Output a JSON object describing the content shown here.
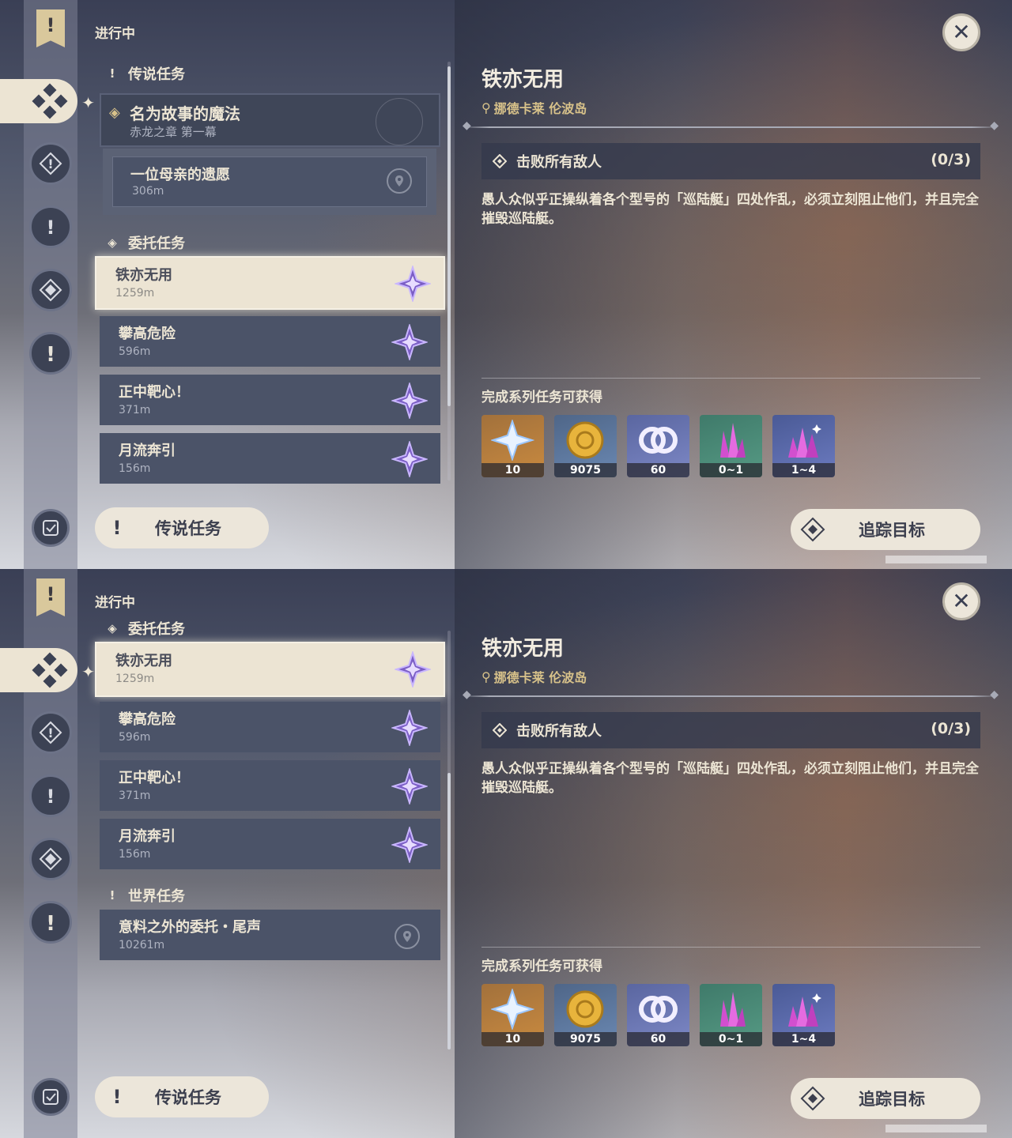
{
  "screens": [
    {
      "status": "进行中",
      "sections": [
        {
          "header": "传说任务"
        },
        {
          "header": "委托任务"
        }
      ],
      "legend_quest": {
        "title": "名为故事的魔法",
        "chapter": "赤龙之章 第一幕"
      },
      "legend_sub": {
        "title": "一位母亲的遗愿",
        "distance": "306m"
      },
      "commissions": [
        {
          "title": "铁亦无用",
          "distance": "1259m"
        },
        {
          "title": "攀高危险",
          "distance": "596m"
        },
        {
          "title": "正中靶心！",
          "distance": "371m"
        },
        {
          "title": "月流奔引",
          "distance": "156m"
        }
      ],
      "legend_button": "传说任务",
      "track_button": "追踪目标"
    },
    {
      "status": "进行中",
      "sections": [
        {
          "header": "委托任务"
        },
        {
          "header": "世界任务"
        }
      ],
      "commissions": [
        {
          "title": "铁亦无用",
          "distance": "1259m"
        },
        {
          "title": "攀高危险",
          "distance": "596m"
        },
        {
          "title": "正中靶心！",
          "distance": "371m"
        },
        {
          "title": "月流奔引",
          "distance": "156m"
        }
      ],
      "world_quest": {
        "title": "意料之外的委托・尾声",
        "distance": "10261m"
      },
      "legend_button": "传说任务",
      "track_button": "追踪目标"
    }
  ],
  "detail": {
    "title": "铁亦无用",
    "location": "挪德卡莱 伦波岛",
    "objective": "击败所有敌人",
    "objective_count": "(0/3)",
    "description": "愚人众似乎正操纵着各个型号的「巡陆艇」四处作乱，必须立刻阻止他们，并且完全摧毁巡陆艇。",
    "rewards_header": "完成系列任务可获得",
    "rewards": [
      {
        "icon": "primogem-icon",
        "count": "10"
      },
      {
        "icon": "mora-icon",
        "count": "9075"
      },
      {
        "icon": "friendship-exp-icon",
        "count": "60"
      },
      {
        "icon": "crystal-ore-icon",
        "count": "0~1"
      },
      {
        "icon": "crystal-cluster-icon",
        "count": "1~4"
      }
    ]
  },
  "colors": {
    "accent_gold": "#d8c28a",
    "panel": "#4b5368",
    "selected": "#ece4d3",
    "star_purple": "#8b6fd1"
  }
}
